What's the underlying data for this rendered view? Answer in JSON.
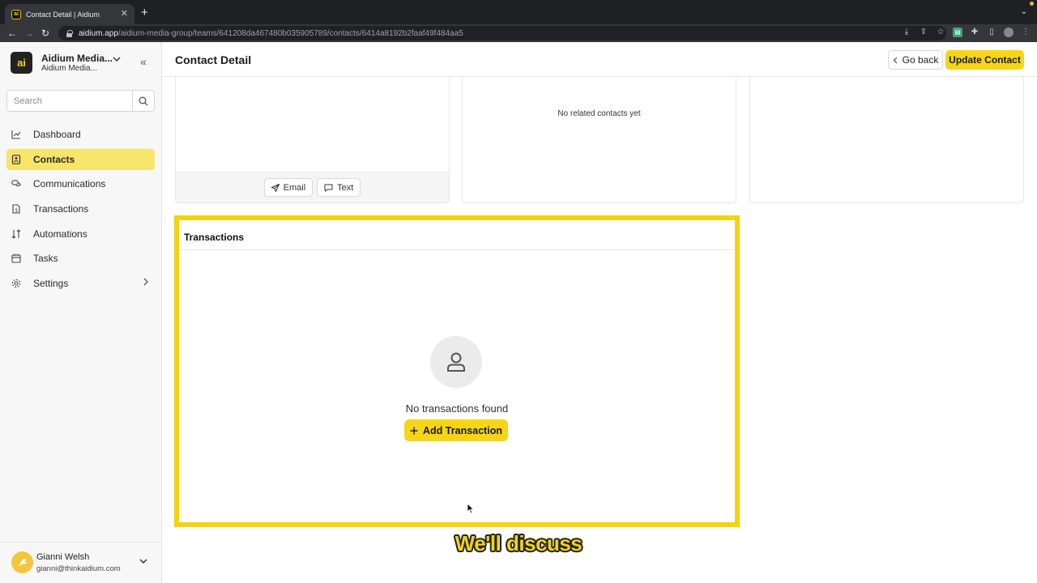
{
  "browser": {
    "tab_title": "Contact Detail | Aidium",
    "url_host": "aidium.app",
    "url_path": "/aidium-media-group/teams/641208da467480b035905789/contacts/6414a8192b2faaf49f484aa5"
  },
  "sidebar": {
    "org_name": "Aidium Media...",
    "org_sub": "Aidium Media...",
    "search_placeholder": "Search",
    "items": [
      {
        "label": "Dashboard",
        "icon": "chart-line-icon"
      },
      {
        "label": "Contacts",
        "icon": "contact-book-icon",
        "active": true
      },
      {
        "label": "Communications",
        "icon": "chat-bubbles-icon"
      },
      {
        "label": "Transactions",
        "icon": "document-dollar-icon"
      },
      {
        "label": "Automations",
        "icon": "sort-arrows-icon"
      },
      {
        "label": "Tasks",
        "icon": "calendar-icon"
      },
      {
        "label": "Settings",
        "icon": "gear-icon",
        "has_submenu": true
      }
    ],
    "user": {
      "name": "Gianni Welsh",
      "email": "gianni@thinkaidium.com"
    }
  },
  "header": {
    "title": "Contact Detail",
    "go_back": "Go back",
    "update": "Update Contact"
  },
  "cards": {
    "email_btn": "Email",
    "text_btn": "Text",
    "related_empty": "No related contacts yet"
  },
  "transactions": {
    "title": "Transactions",
    "empty_text": "No transactions found",
    "add_btn": "Add Transaction"
  },
  "caption": "We'll discuss",
  "colors": {
    "accent": "#f5d516",
    "highlight_border": "#f3d30f",
    "active_nav": "#f7e56a"
  }
}
